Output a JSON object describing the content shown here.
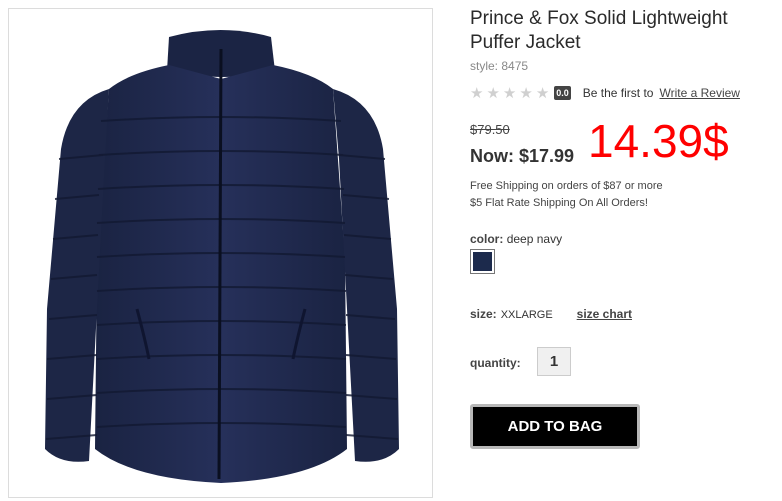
{
  "product": {
    "title": "Prince & Fox Solid Lightweight Puffer Jacket",
    "style": "style: 8475",
    "rating_score": "0.0",
    "rating_stars": 0,
    "review_prompt": "Be the first to",
    "review_link": "Write a Review",
    "was_price": "$79.50",
    "now_price": "Now: $17.99",
    "annotation_price": "14.39$",
    "shipping_line1": "Free Shipping on orders of $87 or more",
    "shipping_line2": "$5 Flat Rate Shipping On All Orders!",
    "color_label": "color:",
    "color_value": "deep navy",
    "swatch_color": "#1c2a4c",
    "size_label": "size:",
    "size_value": "XXLARGE",
    "size_chart": "size chart",
    "quantity_label": "quantity:",
    "quantity_value": "1",
    "add_to_bag": "ADD TO BAG"
  },
  "colors": {
    "jacket": "#1e2848",
    "annotation": "#ff0000",
    "button": "#000000"
  }
}
